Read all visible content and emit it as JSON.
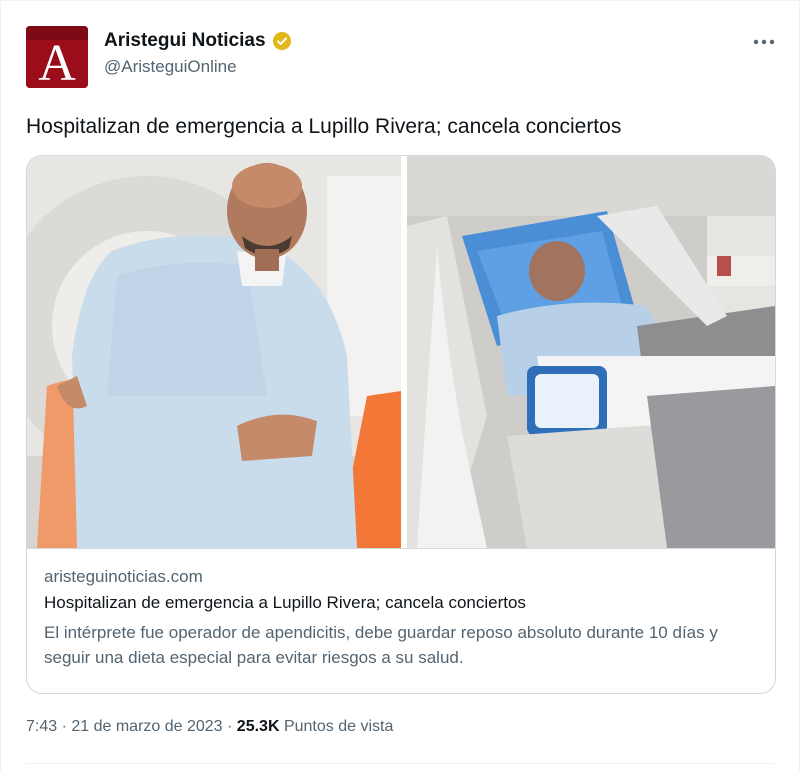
{
  "author": {
    "name": "Aristegui Noticias",
    "handle": "@AristeguiOnline",
    "avatar_letter": "A",
    "verified_icon": "verified-gold-badge"
  },
  "menu_icon": "more-horizontal-icon",
  "tweet": {
    "text": "Hospitalizan de emergencia a Lupillo Rivera; cancela conciertos"
  },
  "card": {
    "domain": "aristeguinoticias.com",
    "title": "Hospitalizan de emergencia a Lupillo Rivera; cancela conciertos",
    "description": "El intérprete fue operador de apendicitis, debe guardar reposo absoluto durante 10 días y seguir una dieta especial para evitar riesgos a su salud."
  },
  "footer": {
    "time": "7:43",
    "separator": " · ",
    "date": "21 de marzo de 2023",
    "views_count": "25.3K",
    "views_label": " Puntos de vista"
  },
  "colors": {
    "brand_red": "#9b0d1a",
    "verified_gold": "#e2b719",
    "muted_text": "#536471"
  }
}
